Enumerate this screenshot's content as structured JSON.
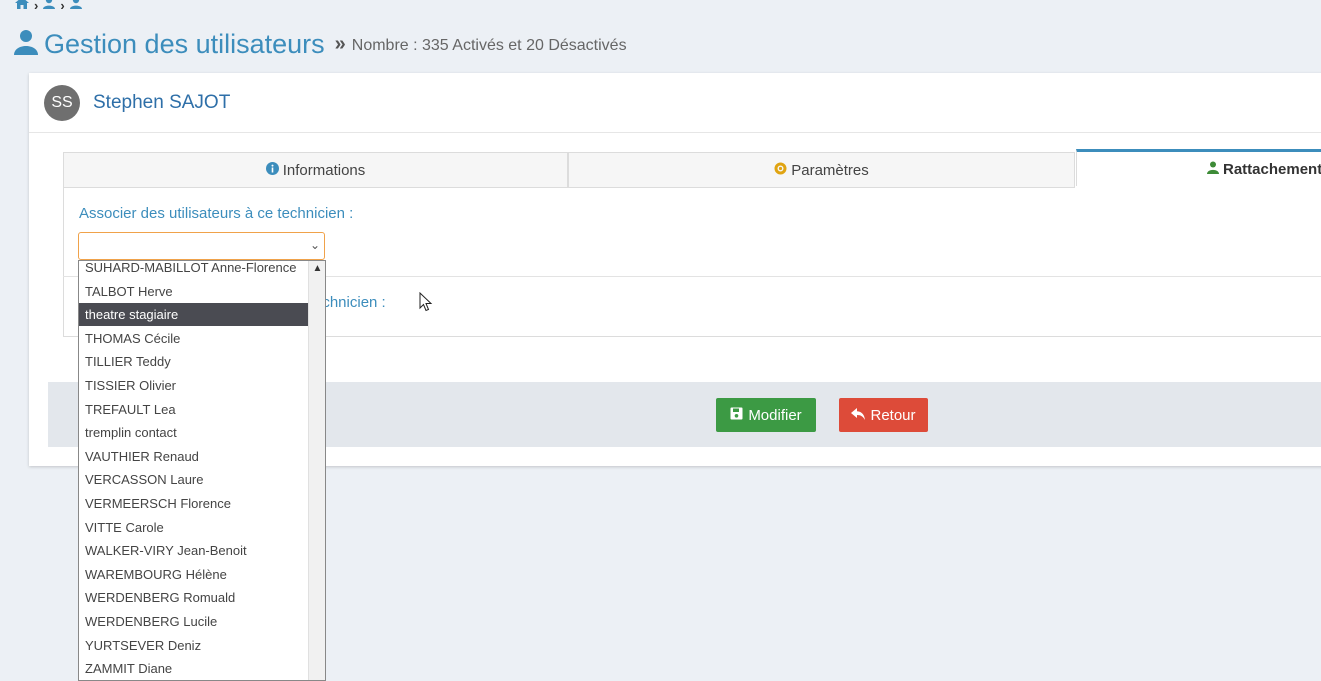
{
  "breadcrumb": {
    "icons": [
      "home-icon",
      "user-icon",
      "user-icon"
    ]
  },
  "header": {
    "title": "Gestion des utilisateurs",
    "count_text": "Nombre : 335 Activés et 20 Désactivés"
  },
  "user": {
    "initials": "SS",
    "name": "Stephen SAJOT"
  },
  "tabs": [
    {
      "label": "Informations",
      "icon": "info-icon"
    },
    {
      "label": "Paramètres",
      "icon": "gear-icon"
    },
    {
      "label": "Rattachement",
      "icon": "user-icon"
    }
  ],
  "form": {
    "associate_label": "Associer des utilisateurs à ce technicien :",
    "select_value": "",
    "second_label_visible": "echnicien :"
  },
  "dropdown": {
    "items": [
      "SUHARD-MABILLOT Anne-Florence",
      "TALBOT Herve",
      "theatre stagiaire",
      "THOMAS Cécile",
      "TILLIER Teddy",
      "TISSIER Olivier",
      "TREFAULT Lea",
      "tremplin contact",
      "VAUTHIER Renaud",
      "VERCASSON Laure",
      "VERMEERSCH Florence",
      "VITTE Carole",
      "WALKER-VIRY Jean-Benoit",
      "WAREMBOURG Hélène",
      "WERDENBERG Romuald",
      "WERDENBERG Lucile",
      "YURTSEVER Deniz",
      "ZAMMIT Diane"
    ],
    "selected": "theatre stagiaire"
  },
  "buttons": {
    "save": "Modifier",
    "back": "Retour"
  },
  "colors": {
    "accent": "#3c8dbc",
    "save": "#3c9a44",
    "back": "#dd4b39",
    "selected_bg": "#4a4b52"
  }
}
